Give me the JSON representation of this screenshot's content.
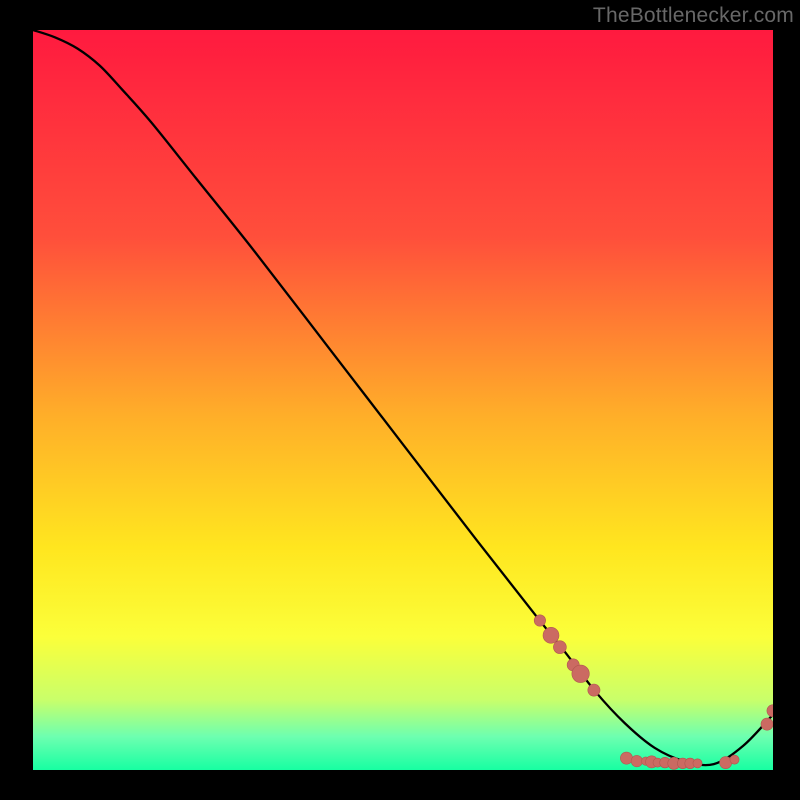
{
  "attribution": "TheBottlenecker.com",
  "colors": {
    "bg": "#000000",
    "attribution_text": "#686868",
    "curve": "#000000",
    "scatter_fill": "#cb6a62",
    "scatter_stroke": "#b15750",
    "gradient_stops": [
      {
        "offset": 0.0,
        "color": "#ff1a3f"
      },
      {
        "offset": 0.28,
        "color": "#ff4f3b"
      },
      {
        "offset": 0.52,
        "color": "#ffae29"
      },
      {
        "offset": 0.7,
        "color": "#ffe61f"
      },
      {
        "offset": 0.82,
        "color": "#fbff3a"
      },
      {
        "offset": 0.905,
        "color": "#c9ff6a"
      },
      {
        "offset": 0.955,
        "color": "#6dffb0"
      },
      {
        "offset": 1.0,
        "color": "#17ffa2"
      }
    ]
  },
  "chart_data": {
    "type": "line",
    "title": "",
    "xlabel": "",
    "ylabel": "",
    "xlim": [
      0,
      100
    ],
    "ylim": [
      0,
      100
    ],
    "series": [
      {
        "name": "curve",
        "x": [
          0,
          3,
          6,
          9,
          12,
          16,
          22,
          30,
          40,
          50,
          60,
          68,
          72,
          76,
          80,
          84,
          88,
          92,
          96,
          100
        ],
        "y": [
          100,
          99,
          97.5,
          95.2,
          92.0,
          87.5,
          80.0,
          70.0,
          57.0,
          44.0,
          31.0,
          20.8,
          15.8,
          10.6,
          6.3,
          3.0,
          1.2,
          0.8,
          3.3,
          7.5
        ]
      }
    ],
    "scatter": [
      {
        "x": 68.5,
        "y": 20.2,
        "r": 3.0
      },
      {
        "x": 70.0,
        "y": 18.2,
        "r": 4.2
      },
      {
        "x": 71.2,
        "y": 16.6,
        "r": 3.4
      },
      {
        "x": 73.0,
        "y": 14.2,
        "r": 3.2
      },
      {
        "x": 74.0,
        "y": 13.0,
        "r": 4.6
      },
      {
        "x": 75.8,
        "y": 10.8,
        "r": 3.2
      },
      {
        "x": 80.2,
        "y": 1.6,
        "r": 3.2
      },
      {
        "x": 81.6,
        "y": 1.2,
        "r": 3.0
      },
      {
        "x": 82.8,
        "y": 1.2,
        "r": 2.2
      },
      {
        "x": 83.6,
        "y": 1.1,
        "r": 3.2
      },
      {
        "x": 84.4,
        "y": 1.0,
        "r": 2.4
      },
      {
        "x": 85.4,
        "y": 1.0,
        "r": 2.8
      },
      {
        "x": 86.6,
        "y": 0.9,
        "r": 3.2
      },
      {
        "x": 87.8,
        "y": 0.9,
        "r": 2.8
      },
      {
        "x": 88.8,
        "y": 0.9,
        "r": 2.8
      },
      {
        "x": 89.8,
        "y": 0.9,
        "r": 2.4
      },
      {
        "x": 93.6,
        "y": 1.0,
        "r": 3.2
      },
      {
        "x": 94.8,
        "y": 1.4,
        "r": 2.4
      },
      {
        "x": 99.2,
        "y": 6.2,
        "r": 3.2
      },
      {
        "x": 100.0,
        "y": 8.0,
        "r": 3.2
      }
    ]
  }
}
